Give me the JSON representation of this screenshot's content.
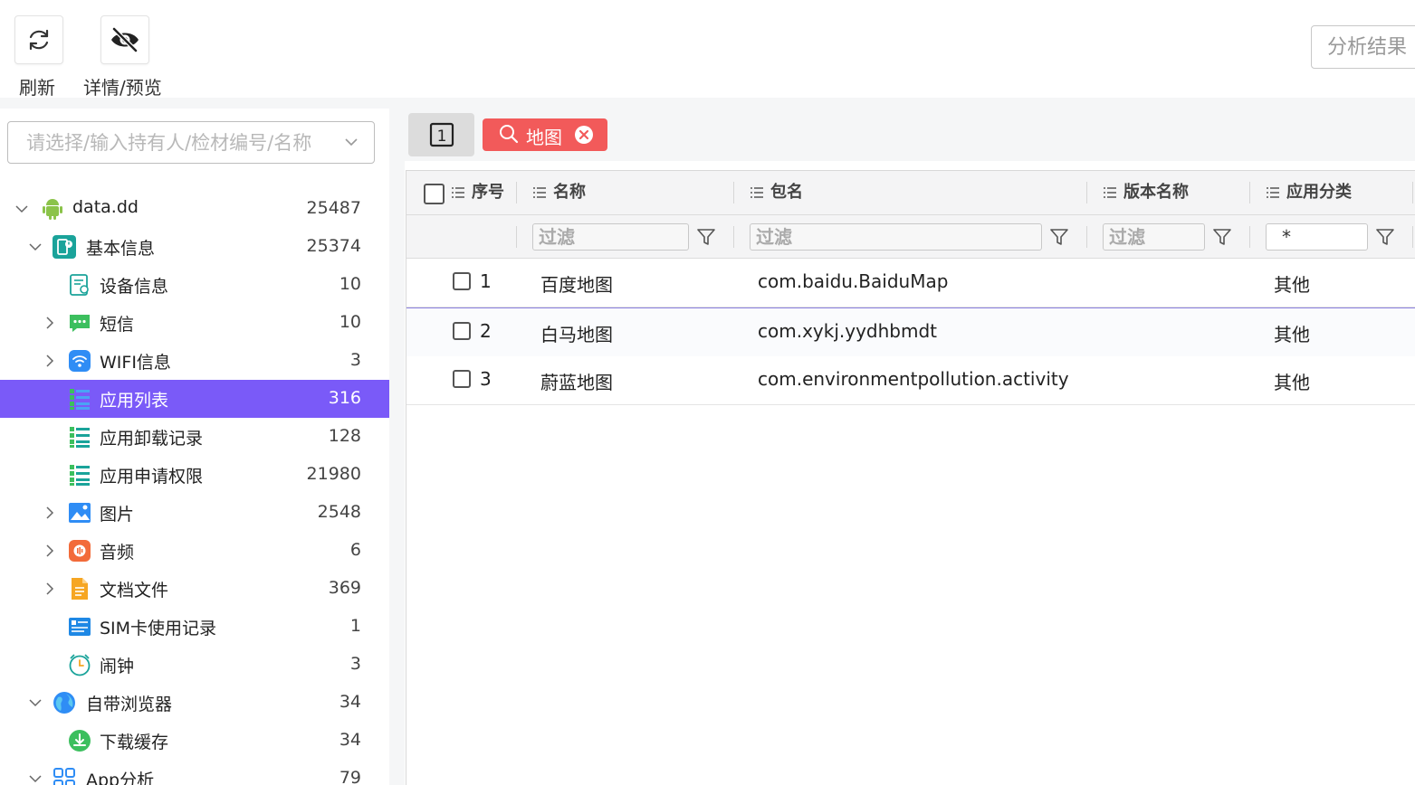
{
  "toolbar": {
    "refresh_label": "刷新",
    "details_label": "详情/预览",
    "analysis_label": "分析结果"
  },
  "sidebar": {
    "search_placeholder": "请选择/输入持有人/检材编号/名称",
    "items": [
      {
        "label": "data.dd",
        "count": "25487",
        "icon": "android-icon",
        "level": 0,
        "expanded": true,
        "selected": false
      },
      {
        "label": "基本信息",
        "count": "25374",
        "icon": "basic-info-icon",
        "level": 1,
        "expanded": true,
        "selected": false
      },
      {
        "label": "设备信息",
        "count": "10",
        "icon": "device-info-icon",
        "level": 2,
        "selected": false
      },
      {
        "label": "短信",
        "count": "10",
        "icon": "sms-icon",
        "level": 2,
        "collapsed": true,
        "selected": false
      },
      {
        "label": "WIFI信息",
        "count": "3",
        "icon": "wifi-icon",
        "level": 2,
        "collapsed": true,
        "selected": false
      },
      {
        "label": "应用列表",
        "count": "316",
        "icon": "app-list-icon",
        "level": 2,
        "selected": true
      },
      {
        "label": "应用卸载记录",
        "count": "128",
        "icon": "app-uninstall-icon",
        "level": 2,
        "selected": false
      },
      {
        "label": "应用申请权限",
        "count": "21980",
        "icon": "app-permission-icon",
        "level": 2,
        "selected": false
      },
      {
        "label": "图片",
        "count": "2548",
        "icon": "image-icon",
        "level": 2,
        "collapsed": true,
        "selected": false
      },
      {
        "label": "音频",
        "count": "6",
        "icon": "audio-icon",
        "level": 2,
        "collapsed": true,
        "selected": false
      },
      {
        "label": "文档文件",
        "count": "369",
        "icon": "document-icon",
        "level": 2,
        "collapsed": true,
        "selected": false
      },
      {
        "label": "SIM卡使用记录",
        "count": "1",
        "icon": "sim-card-icon",
        "level": 2,
        "selected": false
      },
      {
        "label": "闹钟",
        "count": "3",
        "icon": "alarm-clock-icon",
        "level": 2,
        "selected": false
      },
      {
        "label": "自带浏览器",
        "count": "34",
        "icon": "browser-icon",
        "level": 1,
        "expanded": true,
        "selected": false
      },
      {
        "label": "下载缓存",
        "count": "34",
        "icon": "download-cache-icon",
        "level": 2,
        "selected": false
      },
      {
        "label": "App分析",
        "count": "79",
        "icon": "app-analysis-icon",
        "level": 1,
        "expanded": true,
        "selected": false
      }
    ]
  },
  "tabs": {
    "page_number": "1",
    "search_tag": "地图"
  },
  "table": {
    "headers": {
      "index": "序号",
      "name": "名称",
      "package": "包名",
      "version": "版本名称",
      "category": "应用分类"
    },
    "filters": {
      "name_placeholder": "过滤",
      "package_placeholder": "过滤",
      "version_placeholder": "过滤",
      "category_value": "*"
    },
    "rows": [
      {
        "index": "1",
        "name": "百度地图",
        "package": "com.baidu.BaiduMap",
        "version": "",
        "category": "其他"
      },
      {
        "index": "2",
        "name": "白马地图",
        "package": "com.xykj.yydhbmdt",
        "version": "",
        "category": "其他"
      },
      {
        "index": "3",
        "name": "蔚蓝地图",
        "package": "com.environmentpollution.activity",
        "version": "",
        "category": "其他"
      }
    ]
  },
  "colors": {
    "selected_bg": "#7a5af8",
    "search_tag_bg": "#f25a5a",
    "row_highlight_border": "#8b80e0"
  }
}
